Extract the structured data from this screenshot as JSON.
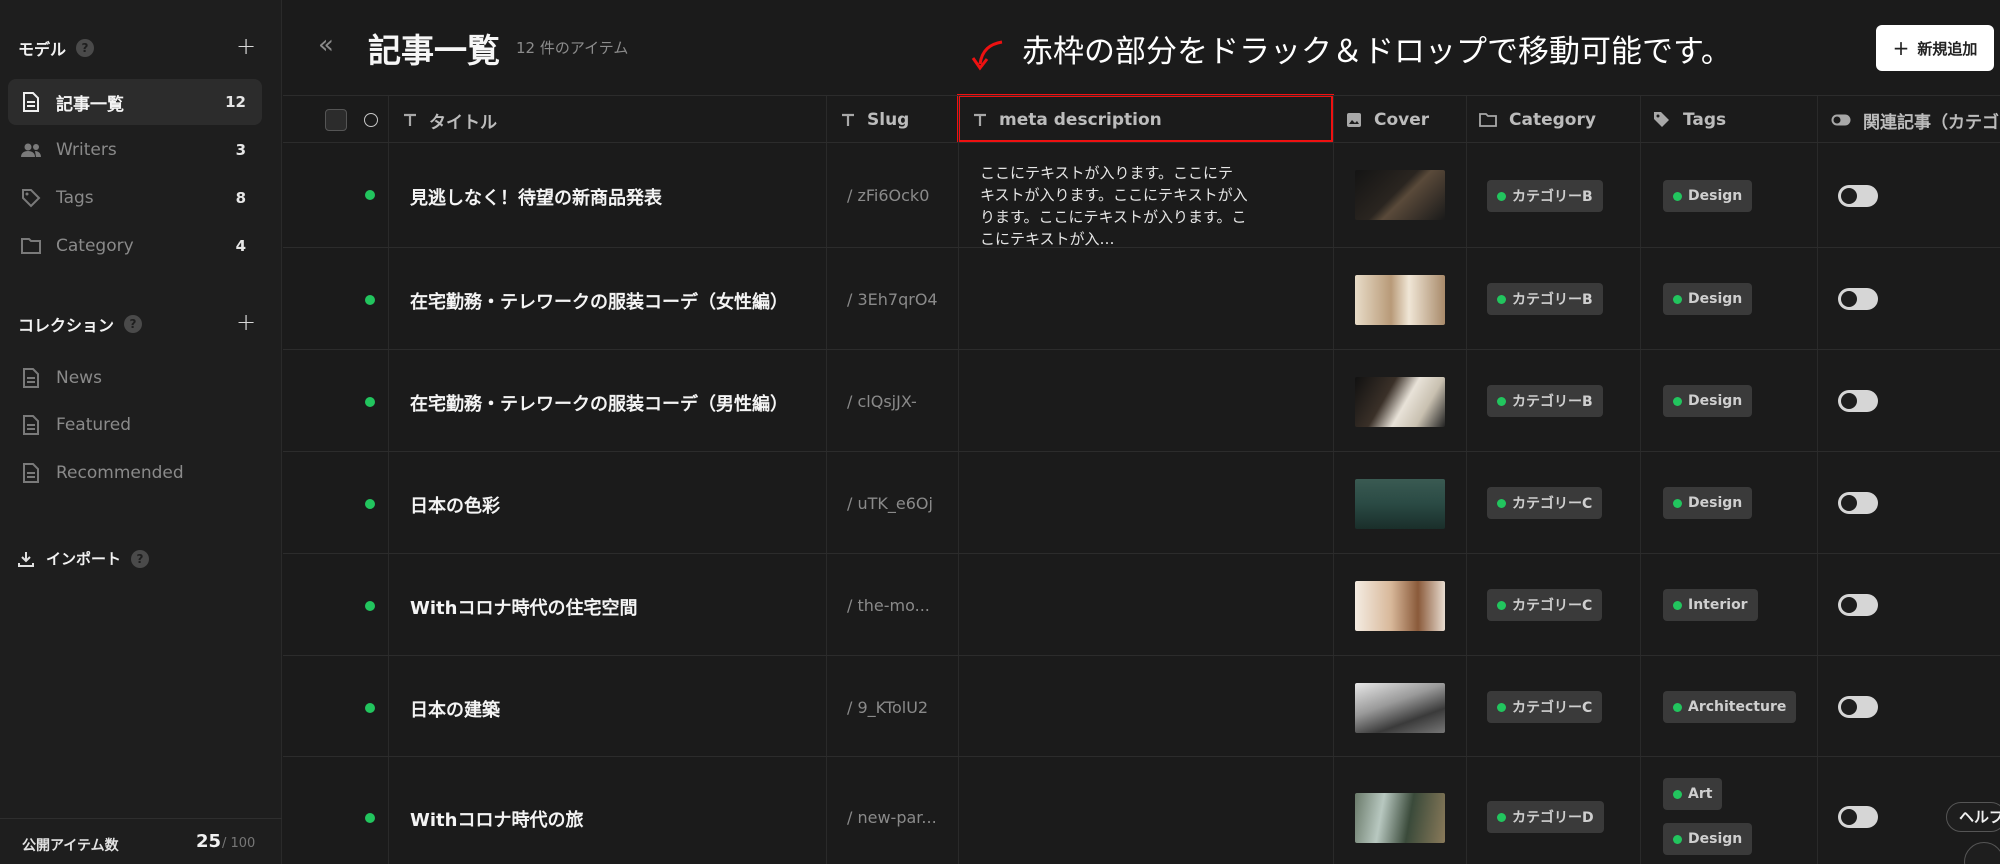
{
  "sidebar": {
    "models_heading": "モデル",
    "models": [
      {
        "label": "記事一覧",
        "count": "12",
        "icon": "document-icon",
        "active": true
      },
      {
        "label": "Writers",
        "count": "3",
        "icon": "users-icon"
      },
      {
        "label": "Tags",
        "count": "8",
        "icon": "tag-icon"
      },
      {
        "label": "Category",
        "count": "4",
        "icon": "folder-icon"
      }
    ],
    "collections_heading": "コレクション",
    "collections": [
      {
        "label": "News",
        "icon": "document-icon"
      },
      {
        "label": "Featured",
        "icon": "document-icon"
      },
      {
        "label": "Recommended",
        "icon": "document-icon"
      }
    ],
    "import_label": "インポート",
    "footer": {
      "label": "公開アイテム数",
      "count": "25",
      "max": "/ 100"
    }
  },
  "header": {
    "title": "記事一覧",
    "item_count": "12 件のアイテム",
    "annotation": "赤枠の部分をドラック＆ドロップで移動可能です。",
    "new_button": "新規追加"
  },
  "columns": {
    "title": "タイトル",
    "slug": "Slug",
    "meta": "meta description",
    "cover": "Cover",
    "category": "Category",
    "tags": "Tags",
    "related": "関連記事（カテゴ"
  },
  "rows": [
    {
      "title": "見逃しなく！待望の新商品発表",
      "slug": "/ zFi6Ock0",
      "meta": "ここにテキストが入ります。ここにテキストが入ります。ここにテキストが入ります。ここにテキストが入ります。ここにテキストが入…",
      "category": "カテゴリーB",
      "tags": [
        "Design"
      ]
    },
    {
      "title": "在宅勤務・テレワークの服装コーデ（女性編）",
      "slug": "/ 3Eh7qrO4",
      "meta": "",
      "category": "カテゴリーB",
      "tags": [
        "Design"
      ]
    },
    {
      "title": "在宅勤務・テレワークの服装コーデ（男性編）",
      "slug": "/ clQsjJX-",
      "meta": "",
      "category": "カテゴリーB",
      "tags": [
        "Design"
      ]
    },
    {
      "title": "日本の色彩",
      "slug": "/ uTK_e6Oj",
      "meta": "",
      "category": "カテゴリーC",
      "tags": [
        "Design"
      ]
    },
    {
      "title": "Withコロナ時代の住宅空間",
      "slug": "/ the-mo...",
      "meta": "",
      "category": "カテゴリーC",
      "tags": [
        "Interior"
      ]
    },
    {
      "title": "日本の建築",
      "slug": "/ 9_KTolU2",
      "meta": "",
      "category": "カテゴリーC",
      "tags": [
        "Architecture"
      ]
    },
    {
      "title": "Withコロナ時代の旅",
      "slug": "/ new-par...",
      "meta": "",
      "category": "カテゴリーD",
      "tags": [
        "Art",
        "Design"
      ]
    }
  ],
  "help_button": "ヘルプ",
  "colors": {
    "accent_red": "#e11111",
    "status_green": "#22c55e",
    "background": "#1b1b1b"
  }
}
